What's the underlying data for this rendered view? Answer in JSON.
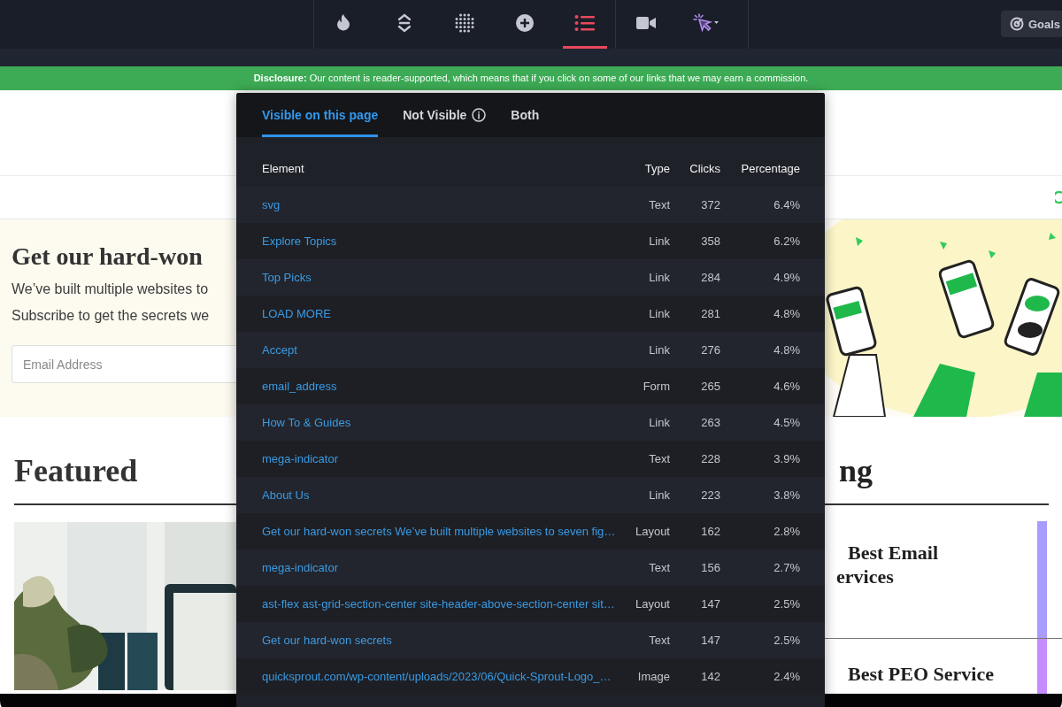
{
  "toolbar": {
    "tools": [
      {
        "kind": "flame",
        "selected": false
      },
      {
        "kind": "updown",
        "selected": false
      },
      {
        "kind": "dots",
        "selected": false
      },
      {
        "kind": "plus",
        "selected": false
      },
      {
        "kind": "list",
        "selected": true
      },
      {
        "kind": "video",
        "selected": false
      },
      {
        "kind": "cursor",
        "selected": false
      }
    ]
  },
  "goals_button": {
    "label": "Goals"
  },
  "disclosure": "**Disclosure:** Our content is reader-supported, which means that if you click on some of our links that we may earn a commission.",
  "website": {
    "newsletter": {
      "heading": "Get our hard-won",
      "text_lines": [
        "We’ve built multiple websites to",
        "Subscribe to get the secrets we"
      ],
      "email_placeholder": "Email Address"
    },
    "featured": {
      "heading": "Featured"
    },
    "trending": {
      "heading": "ng",
      "items": [
        {
          "title_lines": [
            "Best Email",
            "ervices"
          ],
          "color": "#a99cff"
        },
        {
          "title_lines": [
            "Best PEO Service"
          ],
          "color": "#c58cff"
        }
      ]
    }
  },
  "panel": {
    "tabs": [
      {
        "label": "Visible on this page",
        "selected": true,
        "info": false
      },
      {
        "label": "Not Visible",
        "selected": false,
        "info": true
      },
      {
        "label": "Both",
        "selected": false,
        "info": false
      }
    ],
    "columns": [
      "Element",
      "Type",
      "Clicks",
      "Percentage"
    ],
    "rows": [
      {
        "element": "svg",
        "type": "Text",
        "clicks": "372",
        "percentage": "6.4%"
      },
      {
        "element": "Explore Topics",
        "type": "Link",
        "clicks": "358",
        "percentage": "6.2%"
      },
      {
        "element": "Top Picks",
        "type": "Link",
        "clicks": "284",
        "percentage": "4.9%"
      },
      {
        "element": "LOAD MORE",
        "type": "Link",
        "clicks": "281",
        "percentage": "4.8%"
      },
      {
        "element": "Accept",
        "type": "Link",
        "clicks": "276",
        "percentage": "4.8%"
      },
      {
        "element": "email_address",
        "type": "Form",
        "clicks": "265",
        "percentage": "4.6%"
      },
      {
        "element": "How To & Guides",
        "type": "Link",
        "clicks": "263",
        "percentage": "4.5%"
      },
      {
        "element": "mega-indicator",
        "type": "Text",
        "clicks": "228",
        "percentage": "3.9%"
      },
      {
        "element": "About Us",
        "type": "Link",
        "clicks": "223",
        "percentage": "3.8%"
      },
      {
        "element": "Get our hard-won secrets We’ve built multiple websites to seven fig…",
        "type": "Layout",
        "clicks": "162",
        "percentage": "2.8%"
      },
      {
        "element": "mega-indicator",
        "type": "Text",
        "clicks": "156",
        "percentage": "2.7%"
      },
      {
        "element": "ast-flex ast-grid-section-center site-header-above-section-center sit…",
        "type": "Layout",
        "clicks": "147",
        "percentage": "2.5%"
      },
      {
        "element": "Get our hard-won secrets",
        "type": "Text",
        "clicks": "147",
        "percentage": "2.5%"
      },
      {
        "element": "quicksprout.com/wp-content/uploads/2023/06/Quick-Sprout-Logo_…",
        "type": "Image",
        "clicks": "142",
        "percentage": "2.4%"
      }
    ]
  }
}
